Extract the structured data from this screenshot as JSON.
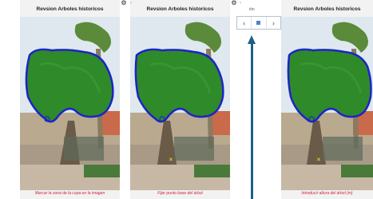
{
  "panels": [
    {
      "title": "Revsion Arboles historicos",
      "caption": "Marcar la zona de la copa en la imagen",
      "has_point": false
    },
    {
      "title": "Revsion Arboles historicos",
      "caption": "Fijar punto base del árbol",
      "has_point": true
    },
    {
      "title": "Revsion Arboles historicos",
      "caption": "Introducir altura del árbol (m)",
      "has_point": true
    }
  ],
  "toolbar": {
    "settings_icon": "gear-icon",
    "chevron_icon": "chevron-right-icon",
    "prev_icon": "chevron-left-icon",
    "next_icon": "chevron-right-icon",
    "page_icon": "page-indicator",
    "header_fragment": "ión"
  },
  "colors": {
    "outline": "#1c24c8",
    "foliage": "#2f8a2a",
    "caption": "#d02040",
    "arrow": "#1f5f86",
    "point": "#f0e020"
  }
}
